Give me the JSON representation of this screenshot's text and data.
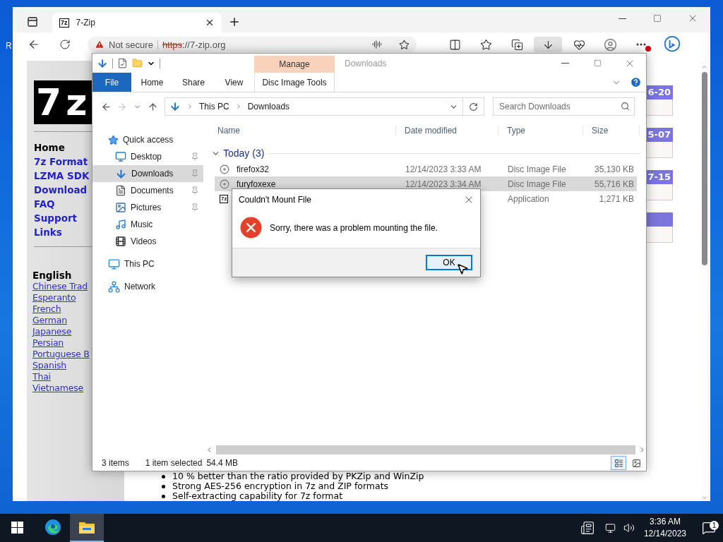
{
  "desktop": {
    "icon_label": "R"
  },
  "browser": {
    "tabs": [
      {
        "favicon_text": "7z",
        "title": "7-Zip",
        "selected": true
      }
    ],
    "address": {
      "security": "Not secure",
      "scheme": "https",
      "rest": "://7-zip.org"
    },
    "page": {
      "logo": "7z",
      "nav": [
        {
          "label": "Home",
          "kind": "current"
        },
        {
          "label": "7z Format",
          "kind": "link"
        },
        {
          "label": "LZMA SDK",
          "kind": "link"
        },
        {
          "label": "Download",
          "kind": "link"
        },
        {
          "label": "FAQ",
          "kind": "link"
        },
        {
          "label": "Support",
          "kind": "link"
        },
        {
          "label": "Links",
          "kind": "link"
        }
      ],
      "language_heading": "English",
      "languages": [
        "Chinese Trad",
        "Esperanto",
        "French",
        "German",
        "Japanese",
        "Persian",
        "Portuguese B",
        "Spanish",
        "Thai",
        "Vietnamese"
      ],
      "news": [
        {
          "date": "6-20"
        },
        {
          "date": "5-07"
        },
        {
          "date": "7-15"
        }
      ],
      "features": [
        "10 % better than the ratio provided by PKZip and WinZip",
        "Strong AES-256 encryption in 7z and ZIP formats",
        "Self-extracting capability for 7z format"
      ]
    }
  },
  "explorer": {
    "title": "Downloads",
    "context_group": "Manage",
    "ribbon_tabs": [
      {
        "label": "File",
        "kind": "file",
        "selected": false
      },
      {
        "label": "Home",
        "kind": "normal",
        "selected": false
      },
      {
        "label": "Share",
        "kind": "normal",
        "selected": false
      },
      {
        "label": "View",
        "kind": "normal",
        "selected": false
      },
      {
        "label": "Disc Image Tools",
        "kind": "context",
        "selected": false
      }
    ],
    "breadcrumb": [
      "This PC",
      "Downloads"
    ],
    "search": {
      "placeholder": "Search Downloads"
    },
    "nav": [
      {
        "label": "Quick access",
        "kind": "star",
        "selected": false,
        "children": [
          {
            "label": "Desktop",
            "kind": "desktop",
            "pinned": true,
            "selected": false
          },
          {
            "label": "Downloads",
            "kind": "download",
            "pinned": true,
            "selected": true
          },
          {
            "label": "Documents",
            "kind": "document",
            "pinned": true,
            "selected": false
          },
          {
            "label": "Pictures",
            "kind": "picture",
            "pinned": true,
            "selected": false
          },
          {
            "label": "Music",
            "kind": "music",
            "pinned": false,
            "selected": false
          },
          {
            "label": "Videos",
            "kind": "video",
            "pinned": false,
            "selected": false
          }
        ]
      },
      {
        "label": "This PC",
        "kind": "pc",
        "selected": false
      },
      {
        "label": "Network",
        "kind": "network",
        "selected": false
      }
    ],
    "columns": [
      "Name",
      "Date modified",
      "Type",
      "Size"
    ],
    "group": {
      "label": "Today (3)",
      "expanded": true
    },
    "rows": [
      {
        "kind": "disc",
        "name": "firefox32",
        "date": "12/14/2023 3:33 AM",
        "type": "Disc Image File",
        "size": "35,130 KB",
        "selected": false
      },
      {
        "kind": "disc",
        "name": "furyfoxexe",
        "date": "12/14/2023 3:34 AM",
        "type": "Disc Image File",
        "size": "55,716 KB",
        "selected": true
      },
      {
        "kind": "app",
        "icon_text": "7z",
        "type": "Application",
        "size": "1,271 KB",
        "selected": false
      }
    ],
    "status": {
      "count": "3 items",
      "selection": "1 item selected",
      "size": "54.4 MB"
    },
    "view_modes": [
      {
        "kind": "details",
        "selected": true
      },
      {
        "kind": "large",
        "selected": false
      }
    ]
  },
  "dialog": {
    "title": "Couldn't Mount File",
    "message": "Sorry, there was a problem mounting the file.",
    "buttons": [
      {
        "label": "OK",
        "focused": true
      }
    ]
  },
  "taskbar": {
    "apps": [
      {
        "kind": "edge",
        "active": false
      },
      {
        "kind": "explorer",
        "active": true
      }
    ],
    "time": "3:36 AM",
    "date": "12/14/2023",
    "notification_count": "1"
  }
}
